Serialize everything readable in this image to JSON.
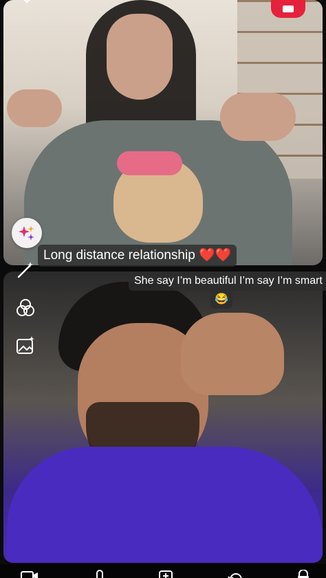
{
  "captions": {
    "top_text": "Long distance relationship",
    "top_hearts": "❤️❤️",
    "bottom_line1": "She say I’m beautiful I’m say I’m smart",
    "bottom_emoji": "😂"
  },
  "icons": {
    "top_left": "chevron-down-icon",
    "top_right": "red-action-button",
    "sparkle": "sparkles-icon",
    "wand": "magic-wand-icon",
    "overlap": "overlapping-circles-icon",
    "image": "image-sparkle-icon",
    "bottom_bar": [
      "camera-icon",
      "mic-icon",
      "add-media-icon",
      "rotate-icon",
      "lock-icon"
    ]
  },
  "colors": {
    "accent_red": "#e5213c",
    "caption_bg": "#2d2d2d",
    "shirt_purple": "#4a2bbf"
  }
}
